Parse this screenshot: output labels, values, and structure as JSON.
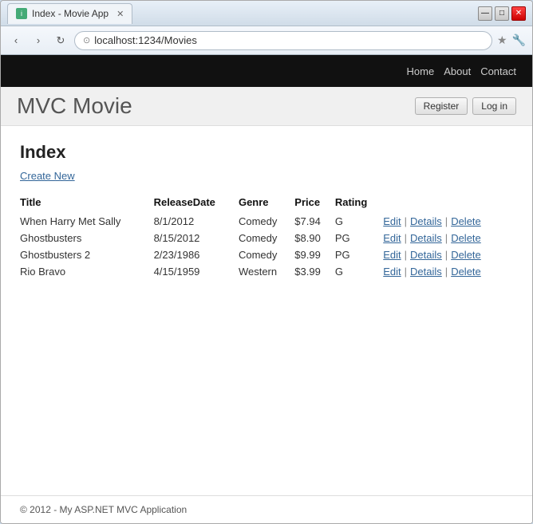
{
  "browser": {
    "tab_label": "Index - Movie App",
    "close_symbol": "✕",
    "minimize_symbol": "—",
    "maximize_symbol": "□",
    "back_symbol": "‹",
    "forward_symbol": "›",
    "refresh_symbol": "↻",
    "address": "localhost:1234/Movies",
    "star_symbol": "★",
    "tool_symbol": "🔧"
  },
  "app": {
    "brand": "MVC Movie",
    "auth": {
      "register_label": "Register",
      "login_label": "Log in"
    },
    "nav": {
      "items": [
        "Home",
        "About",
        "Contact"
      ]
    },
    "page": {
      "title": "Index",
      "create_new_label": "Create New"
    },
    "table": {
      "headers": [
        "Title",
        "ReleaseDate",
        "Genre",
        "Price",
        "Rating",
        ""
      ],
      "rows": [
        {
          "title": "When Harry Met Sally",
          "release_date": "8/1/2012",
          "genre": "Comedy",
          "price": "$7.94",
          "rating": "G"
        },
        {
          "title": "Ghostbusters",
          "release_date": "8/15/2012",
          "genre": "Comedy",
          "price": "$8.90",
          "rating": "PG"
        },
        {
          "title": "Ghostbusters 2",
          "release_date": "2/23/1986",
          "genre": "Comedy",
          "price": "$9.99",
          "rating": "PG"
        },
        {
          "title": "Rio Bravo",
          "release_date": "4/15/1959",
          "genre": "Western",
          "price": "$3.99",
          "rating": "G"
        }
      ],
      "actions": [
        "Edit",
        "|",
        "Details",
        "|",
        "Delete"
      ]
    },
    "footer": "© 2012 - My ASP.NET MVC Application"
  }
}
